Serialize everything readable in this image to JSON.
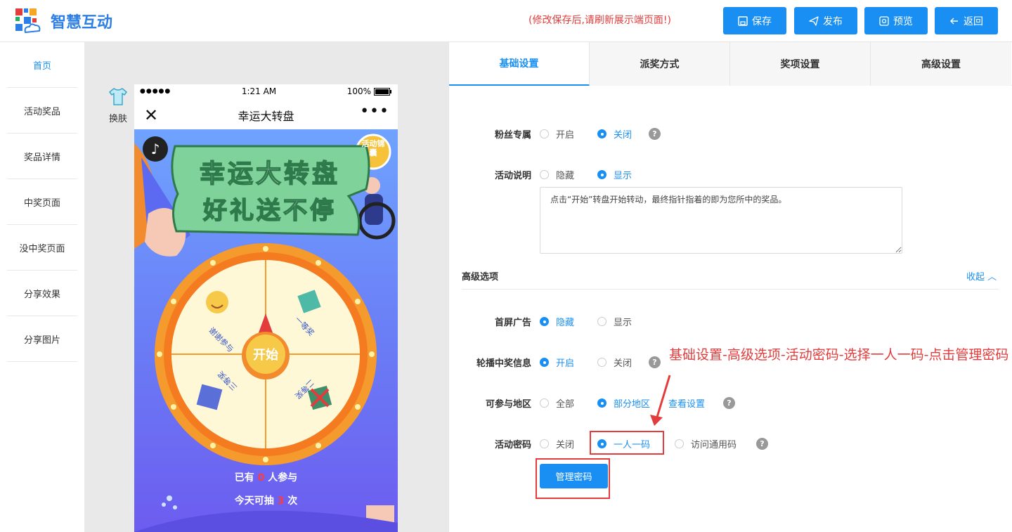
{
  "header": {
    "brand": "智慧互动",
    "notice": "(修改保存后,请刷新展示端页面!)",
    "buttons": {
      "save": "保存",
      "publish": "发布",
      "preview": "预览",
      "back": "返回"
    }
  },
  "leftnav": {
    "items": [
      "首页",
      "活动奖品",
      "奖品详情",
      "中奖页面",
      "没中奖页面",
      "分享效果",
      "分享图片"
    ]
  },
  "preview": {
    "skin_label": "换肤",
    "status": {
      "time": "1:21 AM",
      "battery": "100%",
      "signal": "●●●●●"
    },
    "title": "幸运大转盘",
    "banner_line1": "幸运大转盘",
    "banner_line2": "好礼送不停",
    "badge": "活动锦囊",
    "start_button": "开始",
    "segments": [
      "谢谢参与",
      "一等奖",
      "二等奖",
      "三等奖"
    ],
    "participants_pre": "已有",
    "participants_count": "0",
    "participants_post": "人参与",
    "draws_pre": "今天可抽",
    "draws_count": "3",
    "draws_post": "次"
  },
  "tabs": [
    "基础设置",
    "派奖方式",
    "奖项设置",
    "高级设置"
  ],
  "form": {
    "fans_only": {
      "label": "粉丝专属",
      "opt_on": "开启",
      "opt_off": "关闭"
    },
    "description": {
      "label": "活动说明",
      "opt_hide": "隐藏",
      "opt_show": "显示",
      "text": "点击“开始”转盘开始转动，最终指针指着的即为您所中的奖品。"
    },
    "section_title": "高级选项",
    "collapse": "收起",
    "splash_ad": {
      "label": "首屏广告",
      "opt_hide": "隐藏",
      "opt_show": "显示"
    },
    "carousel": {
      "label": "轮播中奖信息",
      "opt_on": "开启",
      "opt_off": "关闭"
    },
    "region": {
      "label": "可参与地区",
      "opt_all": "全部",
      "opt_part": "部分地区",
      "link": "查看设置"
    },
    "password": {
      "label": "活动密码",
      "opt_off": "关闭",
      "opt_one": "一人一码",
      "opt_common": "访问通用码"
    },
    "manage_button": "管理密码"
  },
  "annotation": "基础设置-高级选项-活动密码-选择一人一码-点击管理密码",
  "colors": {
    "accent": "#1a8ff3",
    "annotation": "#e23c3c"
  }
}
